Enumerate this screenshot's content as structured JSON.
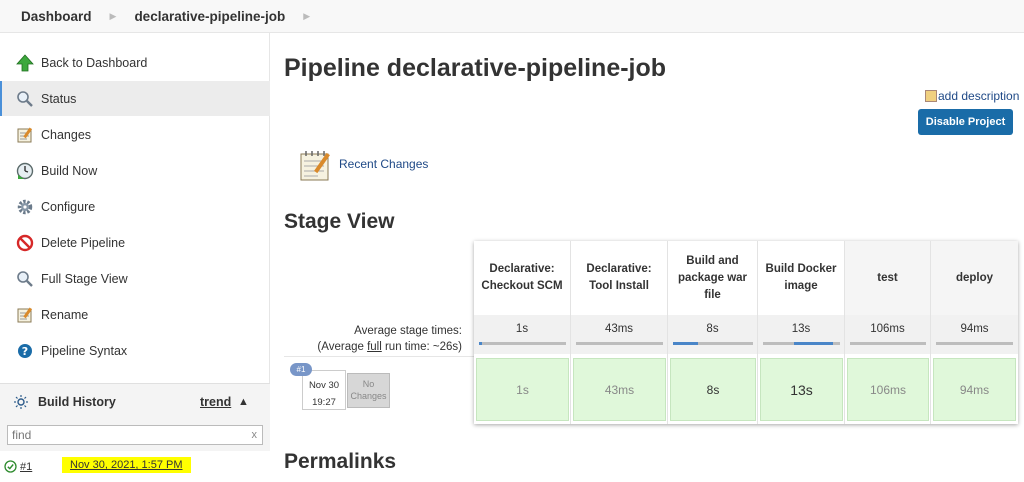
{
  "breadcrumb": {
    "items": [
      "Dashboard",
      "declarative-pipeline-job"
    ]
  },
  "sidebar": {
    "tasks": [
      {
        "label": "Back to Dashboard",
        "icon": "up-arrow-icon"
      },
      {
        "label": "Status",
        "icon": "magnifier-icon",
        "active": true
      },
      {
        "label": "Changes",
        "icon": "notepad-icon"
      },
      {
        "label": "Build Now",
        "icon": "clock-play-icon"
      },
      {
        "label": "Configure",
        "icon": "gear-icon"
      },
      {
        "label": "Delete Pipeline",
        "icon": "no-entry-icon"
      },
      {
        "label": "Full Stage View",
        "icon": "magnifier-icon"
      },
      {
        "label": "Rename",
        "icon": "notepad-icon"
      },
      {
        "label": "Pipeline Syntax",
        "icon": "help-icon"
      }
    ]
  },
  "build_history": {
    "title": "Build History",
    "trend": "trend",
    "filter_placeholder": "find",
    "filter_clear": "x",
    "builds": [
      {
        "number": "#1",
        "date": "Nov 30, 2021, 1:57 PM",
        "status": "success"
      }
    ]
  },
  "main": {
    "title": "Pipeline declarative-pipeline-job",
    "add_description": "add description",
    "disable_button": "Disable Project",
    "recent_changes": "Recent Changes",
    "stage_view_title": "Stage View",
    "permalinks_title": "Permalinks"
  },
  "stage_view": {
    "avg_label_line1": "Average stage times:",
    "avg_label_line2_prefix": "(Average ",
    "avg_label_line2_full": "full",
    "avg_label_line2_suffix": " run time: ~26s)",
    "stages": [
      {
        "name": "Declarative: Checkout SCM",
        "avg": "1s",
        "avg_fraction": 0.04,
        "run": "1s"
      },
      {
        "name": "Declarative: Tool Install",
        "avg": "43ms",
        "avg_fraction": 0.0,
        "run": "43ms"
      },
      {
        "name": "Build and package war file",
        "avg": "8s",
        "avg_fraction": 0.31,
        "run": "8s"
      },
      {
        "name": "Build Docker image",
        "avg": "13s",
        "avg_fraction": 0.5,
        "run": "13s"
      },
      {
        "name": "test",
        "avg": "106ms",
        "avg_fraction": 0.0,
        "run": "106ms"
      },
      {
        "name": "deploy",
        "avg": "94ms",
        "avg_fraction": 0.0,
        "run": "94ms"
      }
    ],
    "build": {
      "badge": "#1",
      "date": "Nov 30",
      "time": "19:27",
      "changes": "No Changes"
    }
  },
  "colors": {
    "accent": "#1a6ca8",
    "success_cell": "#e0f8da",
    "highlight": "#ffff00"
  }
}
